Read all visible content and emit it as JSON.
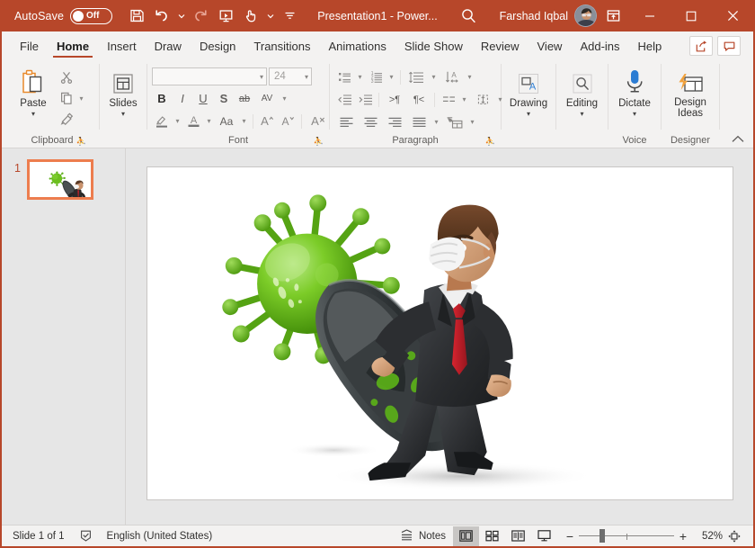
{
  "titlebar": {
    "autosave_label": "AutoSave",
    "autosave_state": "Off",
    "document_title": "Presentation1  -  Power...",
    "user_name": "Farshad Iqbal",
    "qat": [
      {
        "name": "save-icon",
        "label": "Save"
      },
      {
        "name": "undo-icon",
        "label": "Undo"
      },
      {
        "name": "redo-icon",
        "label": "Redo"
      },
      {
        "name": "start-presentation-icon",
        "label": "Start From Beginning"
      },
      {
        "name": "touch-mode-icon",
        "label": "Touch/Mouse Mode"
      },
      {
        "name": "customize-qat-icon",
        "label": "Customize Quick Access Toolbar"
      }
    ],
    "search_icon": "search-icon",
    "ribbon_display_icon": "ribbon-display-options-icon",
    "minimize_icon": "minimize-icon",
    "maximize_icon": "maximize-icon",
    "close_icon": "close-icon",
    "accent_color": "#b7472a"
  },
  "tabs": [
    {
      "label": "File",
      "active": false
    },
    {
      "label": "Home",
      "active": true
    },
    {
      "label": "Insert",
      "active": false
    },
    {
      "label": "Draw",
      "active": false
    },
    {
      "label": "Design",
      "active": false
    },
    {
      "label": "Transitions",
      "active": false
    },
    {
      "label": "Animations",
      "active": false
    },
    {
      "label": "Slide Show",
      "active": false
    },
    {
      "label": "Review",
      "active": false
    },
    {
      "label": "View",
      "active": false
    },
    {
      "label": "Add-ins",
      "active": false
    },
    {
      "label": "Help",
      "active": false
    }
  ],
  "tabs_right": [
    {
      "name": "share-icon",
      "label": "Share"
    },
    {
      "name": "comments-icon",
      "label": "Comments"
    }
  ],
  "ribbon": {
    "clipboard": {
      "group_label": "Clipboard",
      "paste_label": "Paste",
      "cut_icon": "cut-icon",
      "copy_icon": "copy-icon",
      "format_painter_icon": "format-painter-icon",
      "dialog_launcher": "dialog-launcher-icon"
    },
    "slides": {
      "group_label": "",
      "slides_label": "Slides"
    },
    "font": {
      "group_label": "Font",
      "font_name_value": "",
      "font_name_placeholder": "",
      "font_size_value": "24",
      "bold": "B",
      "italic": "I",
      "underline": "U",
      "strikethrough": "S",
      "text_shadow": "ab",
      "char_spacing": "AV",
      "text_highlight_icon": "text-highlight-color-icon",
      "font_color_icon": "font-color-icon",
      "change_case": "Aa",
      "increase_size": "A",
      "decrease_size": "A",
      "clear_formatting_icon": "clear-formatting-icon",
      "dialog_launcher": "dialog-launcher-icon"
    },
    "paragraph": {
      "group_label": "Paragraph",
      "bullets_icon": "bullets-icon",
      "numbering_icon": "numbering-icon",
      "line_spacing_icon": "line-spacing-icon",
      "text_direction_icon": "text-direction-icon",
      "decrease_indent_icon": "decrease-indent-icon",
      "increase_indent_icon": "increase-indent-icon",
      "ltr_icon": "left-to-right-icon",
      "rtl_icon": "right-to-left-icon",
      "columns_icon": "columns-icon",
      "align_text_icon": "align-text-icon",
      "align_left_icon": "align-left-icon",
      "align_center_icon": "align-center-icon",
      "align_right_icon": "align-right-icon",
      "justify_icon": "justify-icon",
      "smartart_icon": "convert-to-smartart-icon",
      "dialog_launcher": "dialog-launcher-icon"
    },
    "drawing": {
      "label": "Drawing",
      "icon": "drawing-shapes-icon"
    },
    "editing": {
      "label": "Editing",
      "icon": "find-search-icon"
    },
    "voice": {
      "group_label": "Voice",
      "label": "Dictate",
      "icon": "microphone-icon"
    },
    "designer": {
      "group_label": "Designer",
      "label_line1": "Design",
      "label_line2": "Ideas",
      "icon": "design-ideas-icon"
    },
    "collapse_icon": "collapse-ribbon-icon"
  },
  "thumbnails": {
    "items": [
      {
        "number": "1",
        "selected": true
      }
    ]
  },
  "slide": {
    "background": "#ffffff",
    "artwork": {
      "name": "businessman-with-shield-vs-virus",
      "virus_color": "#6cbf1f",
      "suit_color": "#2b2b2b",
      "tie_color": "#c0202a",
      "mask_color": "#f2f2f2",
      "hair_color": "#5a3a26",
      "shield_color": "#3a3f41"
    }
  },
  "statusbar": {
    "slide_count_text": "Slide 1 of 1",
    "accessibility_icon": "accessibility-checker-icon",
    "language_text": "English (United States)",
    "notes_label": "Notes",
    "notes_icon": "notes-icon",
    "views": [
      {
        "name": "normal-view-button",
        "icon": "normal-view-icon",
        "active": true
      },
      {
        "name": "slide-sorter-view-button",
        "icon": "slide-sorter-icon",
        "active": false
      },
      {
        "name": "reading-view-button",
        "icon": "reading-view-icon",
        "active": false
      },
      {
        "name": "slide-show-button",
        "icon": "slide-show-icon",
        "active": false
      }
    ],
    "zoom_out": "−",
    "zoom_in": "+",
    "zoom_percent": "52%",
    "fit_icon": "fit-slide-to-window-icon"
  }
}
